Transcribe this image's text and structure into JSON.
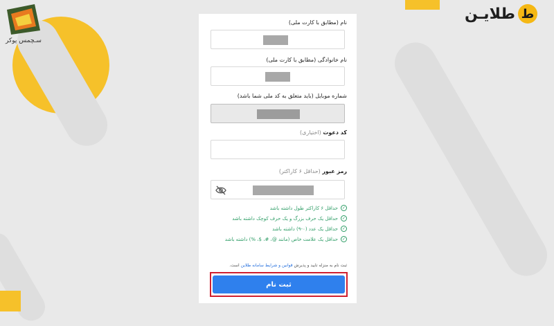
{
  "brand": {
    "name": "طلایـن",
    "mark": "ط",
    "colors": {
      "yellow": "#f5b814"
    }
  },
  "partner": {
    "name": "سـچمس پوکر",
    "icon": "flying-dog-logo-icon"
  },
  "form": {
    "first_name": {
      "label": "نام (مطابق با کارت ملی)"
    },
    "last_name": {
      "label": "نام خانوادگی (مطابق با کارت ملی)"
    },
    "mobile": {
      "label": "شماره موبایل (باید متعلق به کد ملی شما باشد)"
    },
    "invite": {
      "label": "کد دعوت",
      "optional": "(اختیاری)"
    },
    "password": {
      "label": "رمز عبور",
      "hint": "(حداقل ۶ کاراکتر)",
      "toggle_icon": "eye-slash-icon"
    },
    "rules": [
      "حداقل ۶ کاراکتر طول داشته باشد",
      "حداقل یک حرف بزرگ و یک حرف کوچک داشته باشد",
      "حداقل یک عدد (۰-۹) داشته باشد",
      "حداقل یک علامت خاص (مانند @، #، $، %) داشته باشد"
    ],
    "terms_prefix": "ثبت نام به منزله تایید و پذیرش",
    "terms_link": "قوانین و شرایط سامانه طلاین",
    "terms_suffix": "است.",
    "submit": "ثبت نام"
  }
}
